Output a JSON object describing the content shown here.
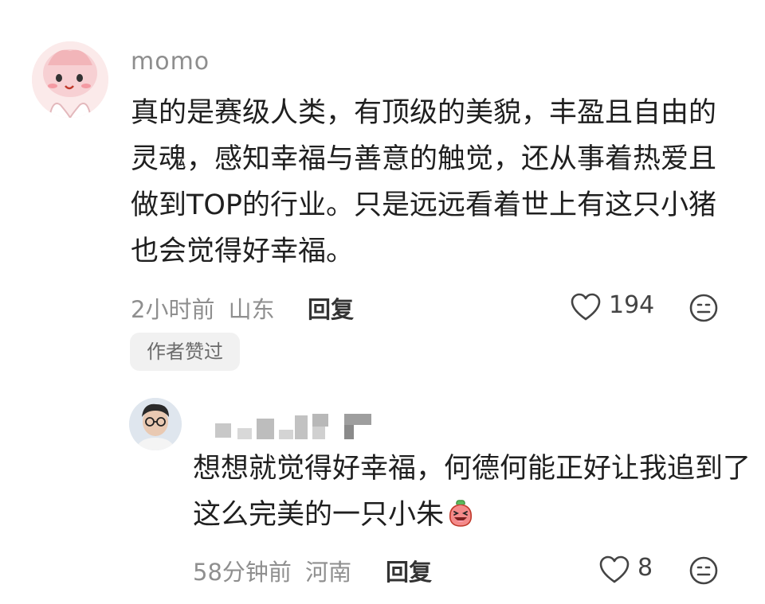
{
  "main_comment": {
    "username": "momo",
    "text": "真的是赛级人类，有顶级的美貌，丰盈且自由的灵魂，感知幸福与善意的触觉，还从事着热爱且做到TOP的行业。只是远远看着世上有这只小猪也会觉得好幸福。",
    "time": "2小时前",
    "location": "山东",
    "reply_label": "回复",
    "like_count": "194",
    "author_tag": "作者赞过"
  },
  "reply_comment": {
    "text": "想想就觉得好幸福，何德何能正好让我追到了这么完美的一只小朱",
    "emoji": "laughing-pig-emoji",
    "time": "58分钟前",
    "location": "河南",
    "reply_label": "回复",
    "like_count": "8"
  },
  "colors": {
    "username": "#8e8e8e",
    "meta": "#8f8f8f",
    "tag_bg": "#f1f1f1"
  },
  "icons": {
    "like": "heart-outline-icon",
    "react": "smiley-face-icon"
  }
}
